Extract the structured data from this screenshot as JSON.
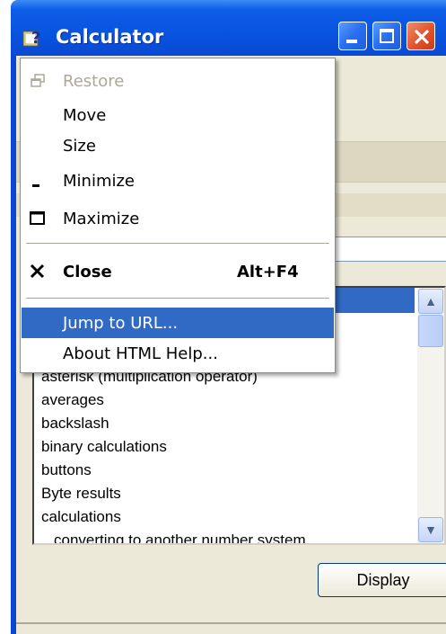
{
  "window": {
    "title": "Calculator",
    "icon": "help-book-icon",
    "controls": [
      "minimize-icon",
      "maximize-icon",
      "close-icon"
    ]
  },
  "system_menu": {
    "items": [
      {
        "label": "Restore",
        "icon": "restore-icon",
        "enabled": false
      },
      {
        "label": "Move",
        "icon": "",
        "enabled": true
      },
      {
        "label": "Size",
        "icon": "",
        "enabled": true
      },
      {
        "label": "Minimize",
        "icon": "minimize-icon",
        "enabled": true
      },
      {
        "label": "Maximize",
        "icon": "maximize-icon",
        "enabled": true
      },
      {
        "label": "Close",
        "shortcut": "Alt+F4",
        "icon": "close-icon",
        "enabled": true,
        "bold": true
      },
      {
        "label": "Jump to URL...",
        "enabled": true,
        "highlighted": true
      },
      {
        "label": "About HTML Help...",
        "enabled": true
      }
    ]
  },
  "index_list": {
    "items": [
      "asterisk (multiplication operator)",
      "averages",
      "backslash",
      "binary calculations",
      "buttons",
      "Byte results",
      "calculations",
      "converting to another number system"
    ]
  },
  "display_button": "Display",
  "colors": {
    "titlebar": "#0854e0",
    "highlight": "#316ac5",
    "client_bg": "#ece9d8"
  }
}
